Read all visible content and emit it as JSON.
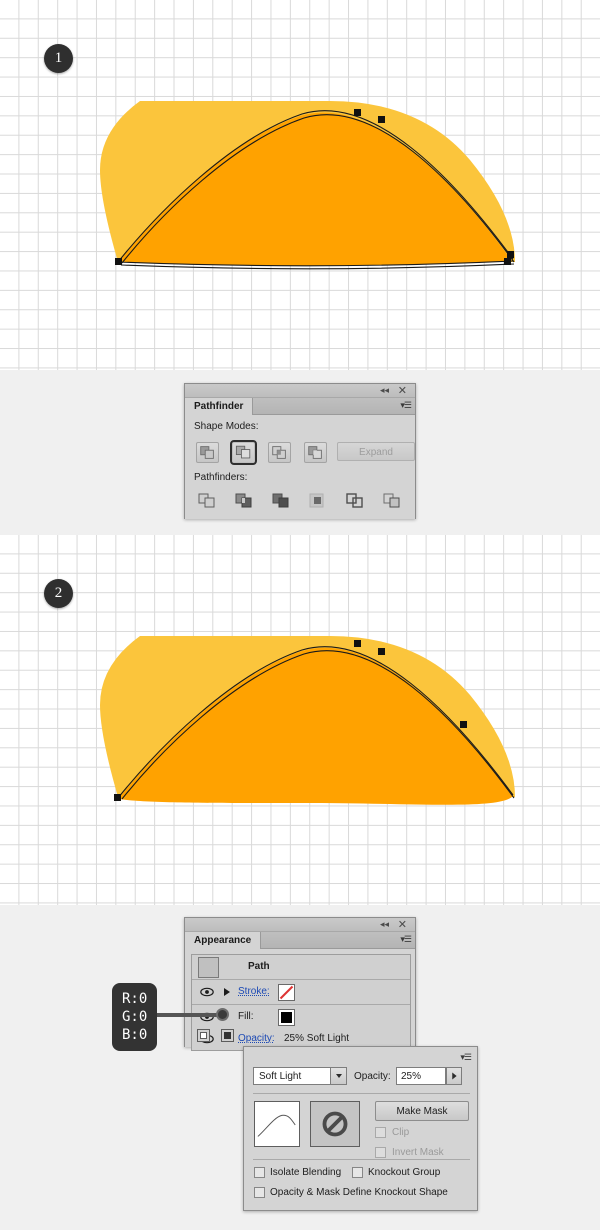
{
  "app": "Adobe Illustrator tutorial steps",
  "steps": [
    {
      "number": "1",
      "caption": ""
    },
    {
      "number": "2",
      "caption": ""
    }
  ],
  "colors": {
    "shape_light_orange": "#FBC53C",
    "shape_dark_orange": "#FFA200",
    "canvas_background": "#FFFFFF",
    "grid_line": "#D9D9D9",
    "page_background": "#F0F0F0",
    "badge_background": "#2F2F2F",
    "panel_background": "#D4D4D4",
    "link_blue": "#1C49B4"
  },
  "pathfinder_panel": {
    "tab_label": "Pathfinder",
    "collapse_icon": "double-chevron-left-icon",
    "close_icon": "close-icon",
    "menu_icon": "panel-menu-icon",
    "shape_modes_label": "Shape Modes:",
    "shape_modes": [
      {
        "name": "unite",
        "label": "Unite",
        "selected": false
      },
      {
        "name": "minus-front",
        "label": "Minus Front",
        "selected": true
      },
      {
        "name": "intersect",
        "label": "Intersect",
        "selected": false
      },
      {
        "name": "exclude",
        "label": "Exclude",
        "selected": false
      }
    ],
    "expand_label": "Expand",
    "expand_enabled": false,
    "pathfinders_label": "Pathfinders:",
    "pathfinders": [
      {
        "name": "divide",
        "label": "Divide"
      },
      {
        "name": "trim",
        "label": "Trim"
      },
      {
        "name": "merge",
        "label": "Merge"
      },
      {
        "name": "crop",
        "label": "Crop"
      },
      {
        "name": "outline",
        "label": "Outline"
      },
      {
        "name": "minus-back",
        "label": "Minus Back"
      }
    ]
  },
  "appearance_panel": {
    "tab_label": "Appearance",
    "collapse_icon": "double-chevron-left-icon",
    "close_icon": "close-icon",
    "menu_icon": "panel-menu-icon",
    "target_label": "Path",
    "rows": [
      {
        "name": "stroke",
        "label": "Stroke:",
        "visible": true,
        "has_disclosure": true,
        "swatch": "none-red-slash"
      },
      {
        "name": "fill",
        "label": "Fill:",
        "visible": true,
        "has_disclosure": false,
        "swatch": "black"
      },
      {
        "name": "opacity",
        "label": "Opacity:",
        "value": "25% Soft Light",
        "visible": true,
        "has_disclosure": false
      }
    ]
  },
  "color_callout": {
    "lines": [
      "R:0",
      "G:0",
      "B:0"
    ],
    "points_to": "fill-swatch"
  },
  "transparency_panel": {
    "menu_icon": "panel-menu-icon",
    "blend_mode": "Soft Light",
    "blend_mode_caret": "chevron-down-icon",
    "opacity_label": "Opacity:",
    "opacity_value": "25%",
    "opacity_stepper_icon": "chevron-right-icon",
    "artwork_thumbnail": "curve-thumbnail",
    "mask_thumbnail": "no-mask-icon",
    "make_mask_label": "Make Mask",
    "checkboxes": [
      {
        "name": "clip",
        "label": "Clip",
        "checked": false,
        "enabled": false
      },
      {
        "name": "invert-mask",
        "label": "Invert Mask",
        "checked": false,
        "enabled": false
      },
      {
        "name": "isolate-blending",
        "label": "Isolate Blending",
        "checked": false,
        "enabled": true
      },
      {
        "name": "knockout-group",
        "label": "Knockout Group",
        "checked": false,
        "enabled": true
      },
      {
        "name": "opacity-mask-knockout",
        "label": "Opacity & Mask Define Knockout Shape",
        "checked": false,
        "enabled": true
      }
    ]
  }
}
